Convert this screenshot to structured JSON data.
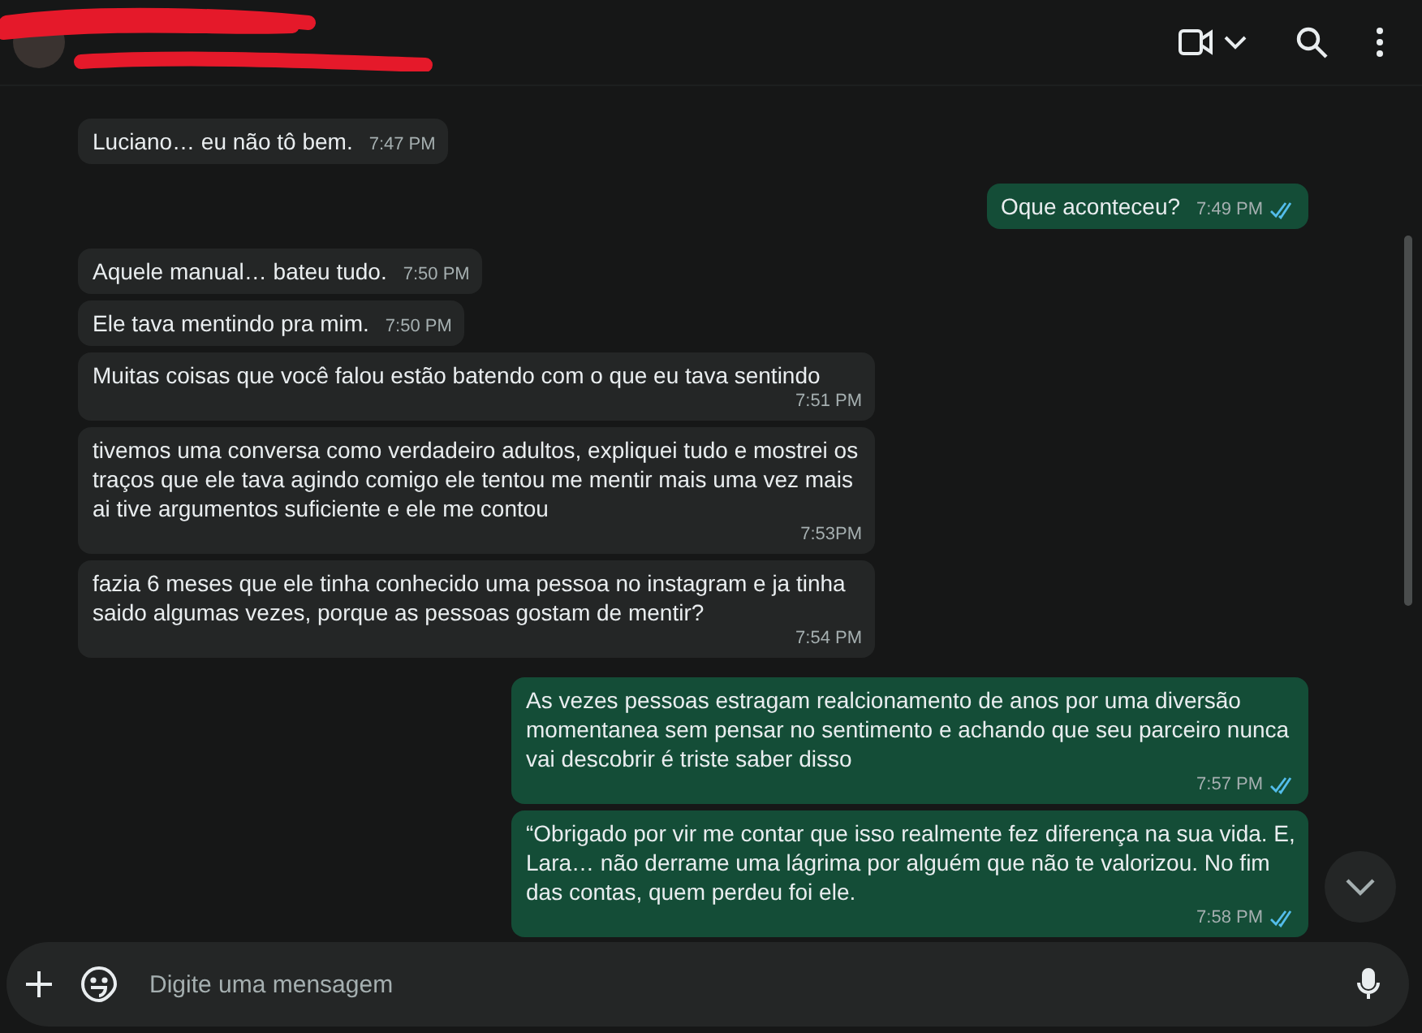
{
  "messages": [
    {
      "kind": "incoming",
      "text": "Luciano… eu não tô bem.",
      "time": "7:47 PM"
    },
    {
      "kind": "outgoing",
      "text": "Oque aconteceu?",
      "time": "7:49 PM",
      "read": true
    },
    {
      "kind": "incoming",
      "text": "Aquele manual… bateu tudo.",
      "time": "7:50 PM"
    },
    {
      "kind": "incoming",
      "text": "Ele tava mentindo pra mim.",
      "time": "7:50 PM"
    },
    {
      "kind": "incoming",
      "text": "Muitas coisas que você falou estão batendo com o que eu tava sentindo",
      "time": "7:51 PM"
    },
    {
      "kind": "incoming",
      "text": "tivemos uma conversa como verdadeiro adultos, expliquei tudo e mostrei os traços que ele tava agindo comigo ele tentou me mentir mais uma vez mais ai tive argumentos suficiente e ele me contou",
      "time": "7:53PM"
    },
    {
      "kind": "incoming",
      "text": "fazia 6 meses que ele tinha conhecido uma pessoa no instagram e ja tinha saido algumas vezes, porque as pessoas gostam de mentir?",
      "time": "7:54 PM"
    },
    {
      "kind": "outgoing",
      "text": "As vezes pessoas estragam realcionamento de anos por uma diversão momentanea sem pensar no sentimento e achando que seu parceiro nunca vai descobrir é triste saber disso",
      "time": "7:57 PM",
      "read": true
    },
    {
      "kind": "outgoing",
      "text": "“Obrigado por vir me contar que isso realmente fez diferença na sua vida. E, Lara… não derrame uma lágrima por alguém que não te valorizou. No fim das contas, quem perdeu foi ele.",
      "time": "7:58 PM",
      "read": true
    }
  ],
  "composer": {
    "placeholder": "Digite uma mensagem"
  }
}
